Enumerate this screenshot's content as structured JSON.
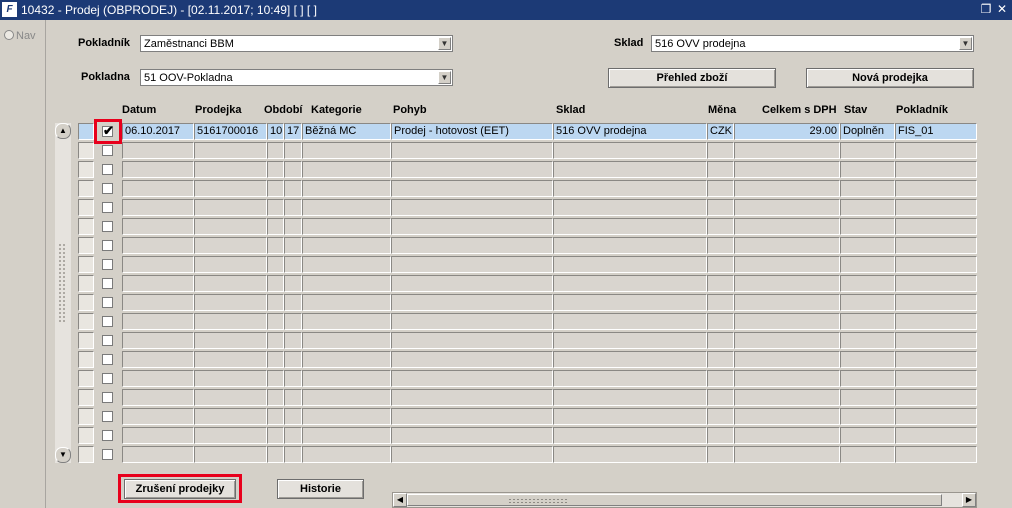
{
  "window": {
    "title": "10432 - Prodej (OBPRODEJ) - [02.11.2017; 10:49]  [ ]  [ ]",
    "app_icon_text": "F",
    "restore_glyph": "❐",
    "close_glyph": "✕"
  },
  "nav": {
    "label": "Nav"
  },
  "header": {
    "pokladnik_label": "Pokladník",
    "pokladnik_value": "Zaměstnanci BBM",
    "pokladna_label": "Pokladna",
    "pokladna_value": "51 OOV-Pokladna",
    "sklad_label": "Sklad",
    "sklad_value": "516 OVV prodejna",
    "prehled_button": "Přehled zboží",
    "nova_button": "Nová prodejka"
  },
  "table": {
    "columns": {
      "datum": "Datum",
      "prodejka": "Prodejka",
      "obdobi": "Období",
      "kategorie": "Kategorie",
      "pohyb": "Pohyb",
      "sklad": "Sklad",
      "mena": "Měna",
      "celkem": "Celkem s DPH",
      "stav": "Stav",
      "pokladnik": "Pokladník"
    },
    "rows": [
      {
        "checked": true,
        "datum": "06.10.2017",
        "prodejka": "5161700016",
        "obdobi_a": "10",
        "obdobi_b": "17",
        "kategorie": "Běžná MC",
        "pohyb": "Prodej - hotovost (EET)",
        "sklad": "516 OVV prodejna",
        "mena": "CZK",
        "celkem": "29.00",
        "stav": "Doplněn",
        "pokladnik": "FIS_01"
      }
    ],
    "empty_row_count": 17
  },
  "footer": {
    "zruseni_button": "Zrušení prodejky",
    "historie_button": "Historie"
  },
  "colors": {
    "titlebar": "#1c3a76",
    "background": "#d4d0c8",
    "active_row": "#bcd7f1",
    "highlight": "#e8001c"
  },
  "icons": {
    "app": "oracle-forms-icon",
    "restore": "restore-window-icon",
    "close": "close-icon",
    "dropdown": "chevron-down-icon"
  }
}
